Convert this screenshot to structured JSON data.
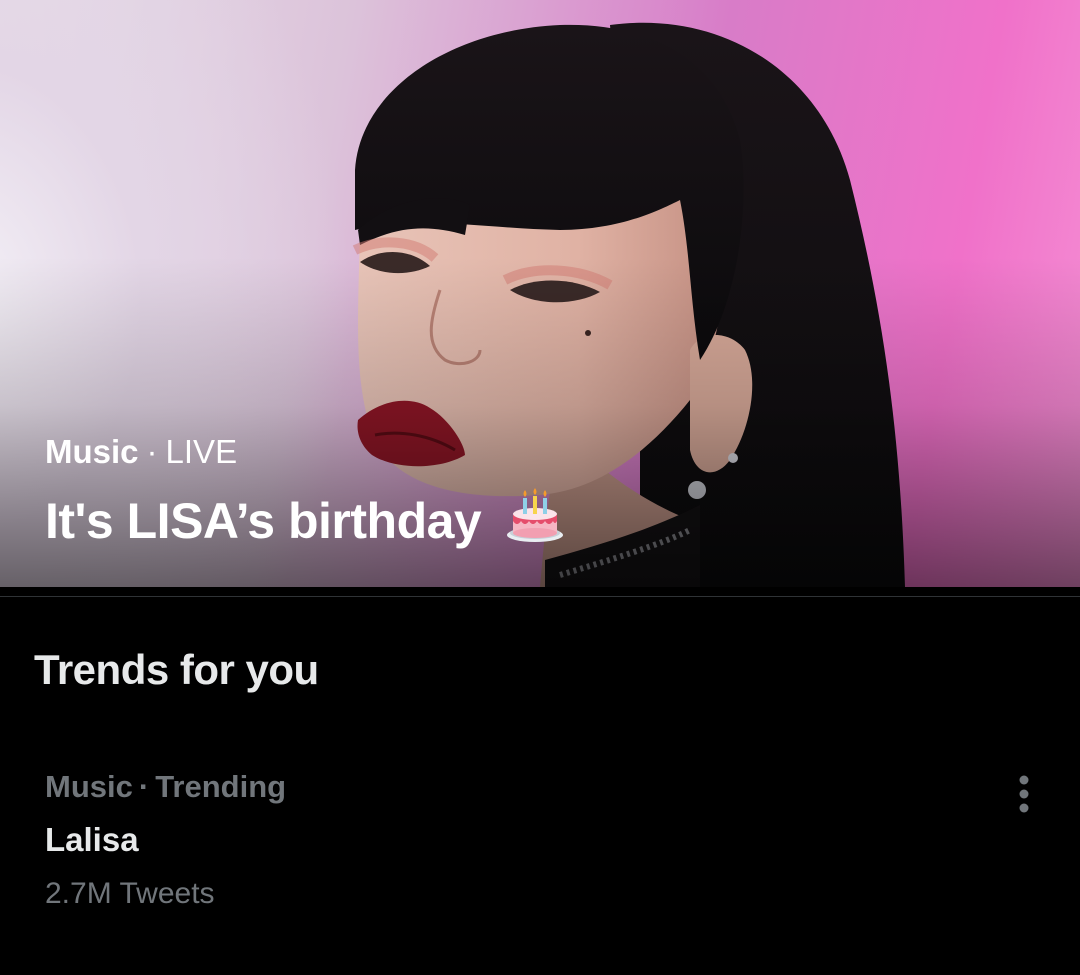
{
  "hero": {
    "category": "Music",
    "separator": "·",
    "status": "LIVE",
    "title": "It's LISA’s birthday",
    "title_emoji": "birthday-cake-icon"
  },
  "trends": {
    "heading": "Trends for you",
    "items": [
      {
        "category": "Music",
        "separator": "·",
        "context": "Trending",
        "name": "Lalisa",
        "count": "2.7M Tweets",
        "menu_icon": "more-vertical-icon"
      }
    ]
  },
  "colors": {
    "background": "#000000",
    "primary_text": "#e7e9ea",
    "secondary_text": "#71767b",
    "divider": "#2f3336",
    "hero_pink": "#f071c9"
  }
}
